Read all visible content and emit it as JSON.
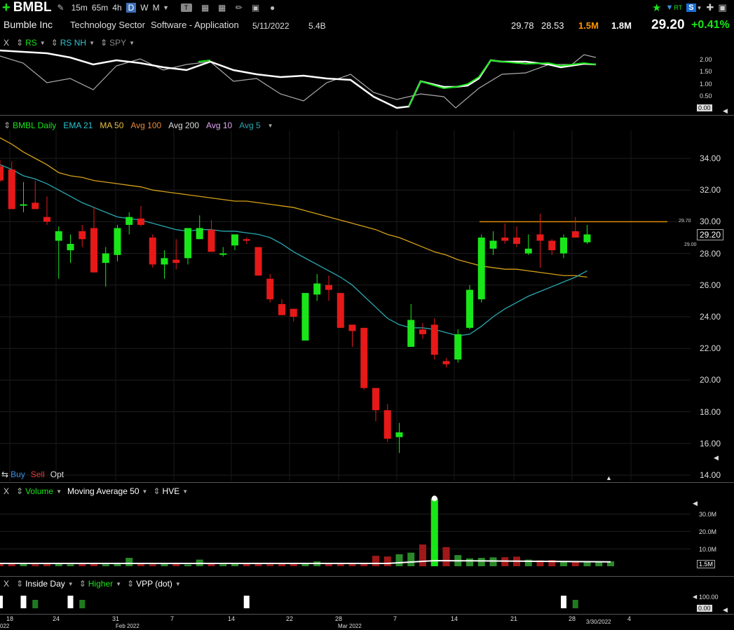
{
  "toolbar": {
    "add_icon": "plus-icon",
    "symbol": "BMBL",
    "timeframes": [
      "15m",
      "65m",
      "4h",
      "D",
      "W",
      "M"
    ],
    "active_timeframe": "D",
    "icons": [
      "share-icon",
      "pencil-icon",
      "save-icon",
      "settings-icon",
      "star-icon",
      "rt-icon",
      "s-icon",
      "expand-icon",
      "window-icon"
    ],
    "rt_label": "RT",
    "s_label": "S"
  },
  "info": {
    "company": "Bumble Inc",
    "sector": "Technology Sector",
    "industry": "Software - Application",
    "date": "5/11/2022",
    "market_cap": "5.4B",
    "high": "29.78",
    "low": "28.53",
    "volume": "1.5M",
    "avg_volume": "1.8M",
    "price": "29.20",
    "change_pct": "+0.41%"
  },
  "rs_panel": {
    "close": "X",
    "labels": [
      "RS",
      "RS NH",
      "SPY"
    ],
    "axis": [
      "2.00",
      "1.50",
      "1.00",
      "0.50"
    ],
    "last_value": "0.00"
  },
  "price_panel": {
    "labels": [
      "BMBL Daily",
      "EMA 21",
      "MA 50",
      "Avg 100",
      "Avg 200",
      "Avg 10",
      "Avg 5"
    ],
    "axis": [
      "34.00",
      "32.00",
      "30.00",
      "28.00",
      "26.00",
      "24.00",
      "22.00",
      "20.00",
      "18.00",
      "16.00",
      "14.00"
    ],
    "current_price": "29.20",
    "resistance_label": "29.70",
    "support_label": "29.00",
    "order_buttons": [
      "Buy",
      "Sell",
      "Opt"
    ]
  },
  "volume_panel": {
    "close": "X",
    "labels": [
      "Volume",
      "Moving Average 50",
      "HVE"
    ],
    "axis": [
      "30.0M",
      "20.0M",
      "10.0M"
    ],
    "current": "1.5M"
  },
  "indicator_panel": {
    "close": "X",
    "labels": [
      "Inside Day",
      "Higher",
      "VPP (dot)"
    ],
    "axis": [
      "100.00",
      "0.00"
    ]
  },
  "x_axis": {
    "ticks": [
      "18",
      "24",
      "31",
      "7",
      "14",
      "22",
      "28",
      "7",
      "14",
      "21",
      "28",
      "4"
    ],
    "months": [
      "Feb 2022",
      "Mar 2022"
    ],
    "left_cut": "022",
    "cursor_date": "3/30/2022"
  },
  "colors": {
    "up": "#19e619",
    "down": "#e61919",
    "ema21": "#2aa8b0",
    "ma50": "#d4a017",
    "rs": "#ffffff",
    "rs_nh": "#19e619",
    "spy": "#aaaaaa",
    "resistance": "#e08a00",
    "accent_vol": "#ff9500",
    "change": "#19e619"
  },
  "chart_data": {
    "type": "candlestick",
    "candles": [
      {
        "o": 33.5,
        "h": 33.9,
        "l": 32.5,
        "c": 32.6
      },
      {
        "o": 33.3,
        "h": 33.8,
        "l": 30.8,
        "c": 30.8
      },
      {
        "o": 31.1,
        "h": 32.5,
        "l": 30.6,
        "c": 31.1
      },
      {
        "o": 31.2,
        "h": 32.6,
        "l": 30.8,
        "c": 30.8
      },
      {
        "o": 30.3,
        "h": 31.6,
        "l": 29.8,
        "c": 30.0
      },
      {
        "o": 28.8,
        "h": 29.7,
        "l": 26.4,
        "c": 29.4
      },
      {
        "o": 28.2,
        "h": 29.2,
        "l": 27.4,
        "c": 28.6
      },
      {
        "o": 29.4,
        "h": 29.8,
        "l": 28.4,
        "c": 28.9
      },
      {
        "o": 29.6,
        "h": 30.9,
        "l": 26.8,
        "c": 26.8
      },
      {
        "o": 27.4,
        "h": 28.4,
        "l": 25.9,
        "c": 28.0
      },
      {
        "o": 27.9,
        "h": 29.8,
        "l": 27.5,
        "c": 29.6
      },
      {
        "o": 29.8,
        "h": 30.6,
        "l": 29.2,
        "c": 30.3
      },
      {
        "o": 30.2,
        "h": 31.0,
        "l": 29.7,
        "c": 29.8
      },
      {
        "o": 29.0,
        "h": 29.2,
        "l": 27.1,
        "c": 27.3
      },
      {
        "o": 27.3,
        "h": 28.2,
        "l": 26.4,
        "c": 27.7
      },
      {
        "o": 27.6,
        "h": 28.9,
        "l": 27.0,
        "c": 27.4
      },
      {
        "o": 27.7,
        "h": 29.5,
        "l": 27.3,
        "c": 29.6
      },
      {
        "o": 28.9,
        "h": 30.4,
        "l": 28.9,
        "c": 29.6
      },
      {
        "o": 29.5,
        "h": 30.1,
        "l": 28.4,
        "c": 28.1
      },
      {
        "o": 28.0,
        "h": 28.4,
        "l": 27.8,
        "c": 28.0
      },
      {
        "o": 28.5,
        "h": 29.2,
        "l": 28.2,
        "c": 29.2
      },
      {
        "o": 28.9,
        "h": 29.0,
        "l": 28.6,
        "c": 28.8
      },
      {
        "o": 28.4,
        "h": 28.4,
        "l": 26.7,
        "c": 26.6
      },
      {
        "o": 26.4,
        "h": 26.7,
        "l": 24.9,
        "c": 25.1
      },
      {
        "o": 24.8,
        "h": 25.1,
        "l": 24.3,
        "c": 24.1
      },
      {
        "o": 24.5,
        "h": 24.5,
        "l": 23.7,
        "c": 24.0
      },
      {
        "o": 22.5,
        "h": 25.1,
        "l": 22.6,
        "c": 25.5
      },
      {
        "o": 25.4,
        "h": 26.7,
        "l": 25.0,
        "c": 26.1
      },
      {
        "o": 26.0,
        "h": 26.6,
        "l": 25.0,
        "c": 25.7
      },
      {
        "o": 25.5,
        "h": 25.5,
        "l": 23.3,
        "c": 23.3
      },
      {
        "o": 23.5,
        "h": 23.5,
        "l": 22.1,
        "c": 23.1
      },
      {
        "o": 23.3,
        "h": 23.3,
        "l": 19.4,
        "c": 19.5
      },
      {
        "o": 19.5,
        "h": 19.5,
        "l": 17.4,
        "c": 18.1
      },
      {
        "o": 18.1,
        "h": 18.5,
        "l": 16.1,
        "c": 16.3
      },
      {
        "o": 16.4,
        "h": 17.3,
        "l": 15.4,
        "c": 16.7
      },
      {
        "o": 22.1,
        "h": 24.8,
        "l": 22.1,
        "c": 23.8
      },
      {
        "o": 23.2,
        "h": 23.6,
        "l": 22.6,
        "c": 22.9
      },
      {
        "o": 23.5,
        "h": 23.9,
        "l": 21.3,
        "c": 21.6
      },
      {
        "o": 21.2,
        "h": 21.4,
        "l": 20.8,
        "c": 21.0
      },
      {
        "o": 21.3,
        "h": 23.2,
        "l": 21.1,
        "c": 22.9
      },
      {
        "o": 23.3,
        "h": 26.0,
        "l": 23.2,
        "c": 25.7
      },
      {
        "o": 25.1,
        "h": 29.2,
        "l": 24.9,
        "c": 29.0
      },
      {
        "o": 28.3,
        "h": 29.4,
        "l": 27.9,
        "c": 28.8
      },
      {
        "o": 29.0,
        "h": 29.9,
        "l": 28.6,
        "c": 28.8
      },
      {
        "o": 29.0,
        "h": 29.7,
        "l": 28.4,
        "c": 28.6
      },
      {
        "o": 28.0,
        "h": 29.2,
        "l": 27.9,
        "c": 28.3
      },
      {
        "o": 29.2,
        "h": 30.5,
        "l": 27.1,
        "c": 28.8
      },
      {
        "o": 28.8,
        "h": 28.9,
        "l": 27.9,
        "c": 28.2
      },
      {
        "o": 28.0,
        "h": 29.2,
        "l": 27.7,
        "c": 29.0
      },
      {
        "o": 29.4,
        "h": 30.3,
        "l": 29.1,
        "c": 29.0
      },
      {
        "o": 28.7,
        "h": 29.8,
        "l": 28.6,
        "c": 29.2
      }
    ],
    "ema21": [
      33.6,
      33.3,
      32.9,
      32.7,
      32.4,
      32.0,
      31.6,
      31.2,
      30.9,
      30.6,
      30.3,
      30.2,
      30.1,
      29.9,
      29.7,
      29.5,
      29.4,
      29.5,
      29.5,
      29.4,
      29.4,
      29.3,
      29.2,
      29.0,
      28.6,
      28.1,
      27.7,
      27.3,
      26.9,
      26.5,
      26.0,
      25.3,
      24.6,
      23.9,
      23.5,
      23.3,
      23.3,
      23.2,
      23.0,
      22.8,
      22.9,
      23.4,
      24.0,
      24.5,
      24.9,
      25.3,
      25.6,
      25.9,
      26.2,
      26.5,
      26.9
    ],
    "ma50": [
      35.3,
      34.9,
      34.4,
      34.0,
      33.6,
      33.1,
      32.9,
      32.8,
      32.6,
      32.5,
      32.4,
      32.3,
      32.2,
      32.0,
      31.9,
      31.8,
      31.7,
      31.6,
      31.5,
      31.4,
      31.3,
      31.3,
      31.2,
      31.1,
      31.0,
      30.9,
      30.7,
      30.5,
      30.3,
      30.1,
      29.9,
      29.7,
      29.5,
      29.2,
      29.0,
      28.7,
      28.4,
      28.1,
      27.9,
      27.6,
      27.4,
      27.2,
      27.1,
      27.0,
      27.0,
      26.9,
      26.8,
      26.7,
      26.6,
      26.6,
      26.5
    ],
    "resistance": 30.0,
    "volume": [
      1.3,
      1.2,
      1.4,
      1.1,
      1.3,
      1.2,
      1.1,
      1.5,
      1.3,
      1.1,
      1.2,
      4.8,
      1.3,
      1.1,
      1.2,
      1.4,
      1.0,
      3.8,
      1.4,
      1.1,
      1.2,
      1.3,
      1.5,
      1.1,
      1.2,
      1.2,
      1.4,
      2.8,
      1.2,
      1.3,
      1.4,
      1.5,
      6.0,
      5.6,
      6.9,
      7.8,
      12.5,
      39.0,
      11.0,
      6.4,
      4.5,
      4.8,
      5.1,
      5.2,
      5.5,
      3.8,
      3.4,
      3.6,
      3.0,
      2.9,
      2.6,
      2.5,
      2.8
    ]
  }
}
